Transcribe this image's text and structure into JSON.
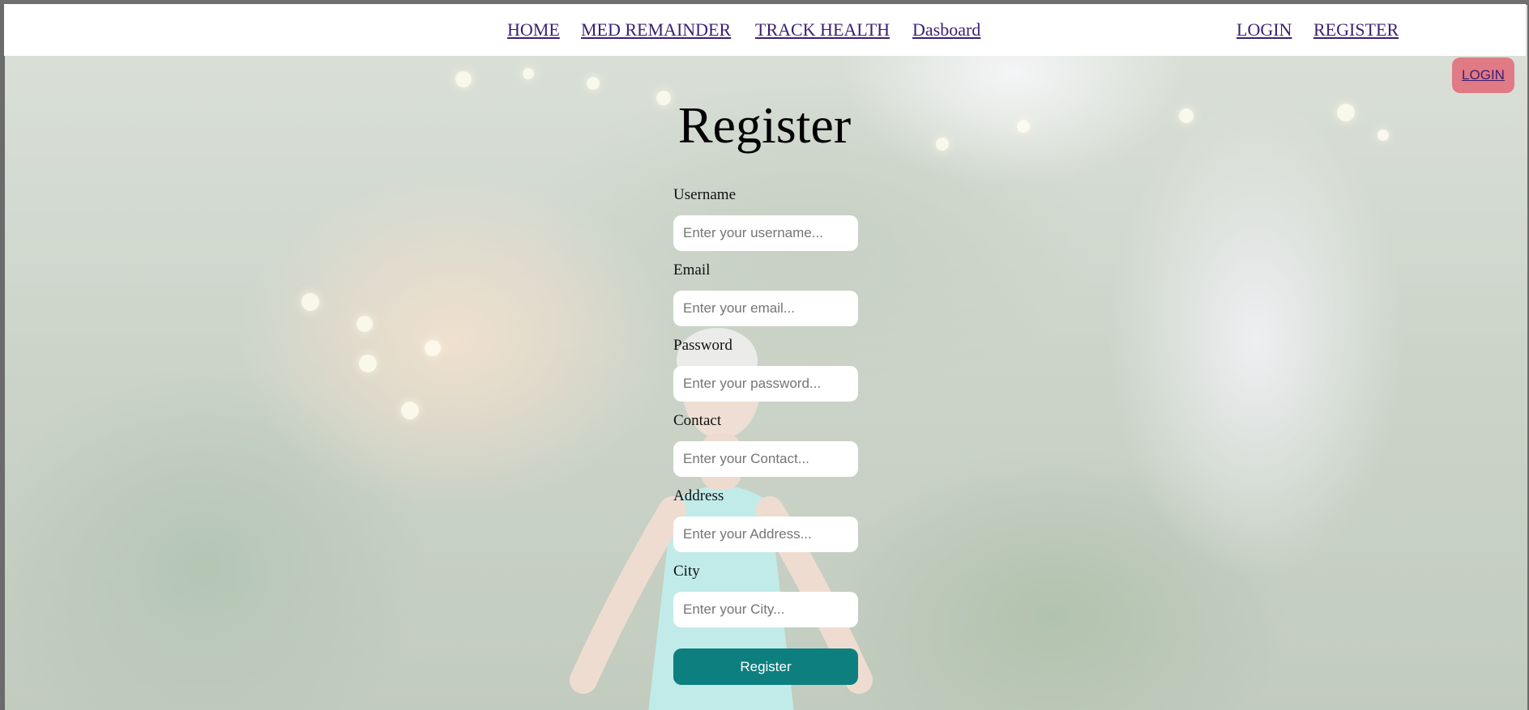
{
  "nav": {
    "items": [
      {
        "label": "HOME"
      },
      {
        "label": "MED REMAINDER"
      },
      {
        "label": "TRACK HEALTH"
      },
      {
        "label": "Dasboard"
      }
    ],
    "auth": [
      {
        "label": "LOGIN"
      },
      {
        "label": "REGISTER"
      }
    ],
    "link_color": "#3b1e72"
  },
  "floating_login": {
    "label": "LOGIN",
    "color": "#e07a84"
  },
  "form": {
    "title": "Register",
    "fields": [
      {
        "label": "Username",
        "placeholder": "Enter your username..."
      },
      {
        "label": "Email",
        "placeholder": "Enter your email..."
      },
      {
        "label": "Password",
        "placeholder": "Enter your password..."
      },
      {
        "label": "Contact",
        "placeholder": "Enter your Contact..."
      },
      {
        "label": "Address",
        "placeholder": "Enter your Address..."
      },
      {
        "label": "City",
        "placeholder": "Enter your City..."
      }
    ],
    "submit_label": "Register",
    "submit_color": "#0d7f7f"
  }
}
